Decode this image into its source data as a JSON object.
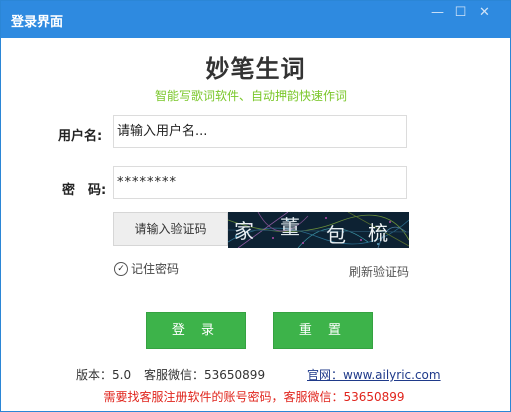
{
  "window": {
    "title": "登录界面",
    "minimize_glyph": "—",
    "maximize_glyph": "☐",
    "close_glyph": "✕"
  },
  "header": {
    "title": "妙笔生词",
    "subtitle": "智能写歌词软件、自动押韵快速作词"
  },
  "form": {
    "username_label": "用户名:",
    "username_value": "请输入用户名...",
    "password_label": "密　码:",
    "password_value": "********",
    "captcha_placeholder": "请输入验证码",
    "captcha_text": [
      "家",
      "董",
      "包",
      "梳"
    ],
    "remember_label": "记住密码",
    "refresh_captcha": "刷新验证码"
  },
  "buttons": {
    "login": "登 录",
    "reset": "重 置"
  },
  "footer": {
    "version": "版本：5.0",
    "service_wechat": "客服微信：53650899",
    "website": "官网：www.ailyric.com",
    "notice": "需要找客服注册软件的账号密码，客服微信：53650899"
  },
  "colors": {
    "titlebar": "#2e8ae0",
    "accent_green": "#3db34a",
    "subtitle_green": "#7ac72a",
    "notice_red": "#e0241c"
  }
}
